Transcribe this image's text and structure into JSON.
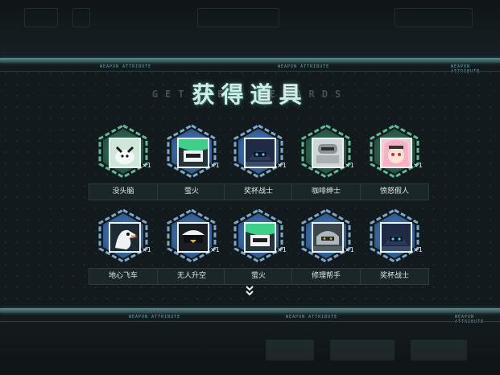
{
  "band_text": "WEAPON ATTRIBUTE",
  "title": {
    "main": "获得道具",
    "ghost": "GET NEW REWARDS"
  },
  "items": [
    {
      "name": "没头脑",
      "qty": "×1",
      "frame": "green",
      "portrait": "white-creature"
    },
    {
      "name": "萤火",
      "qty": "×1",
      "frame": "blue",
      "portrait": "green-hair-visor"
    },
    {
      "name": "奖杯战士",
      "qty": "×1",
      "frame": "blue",
      "portrait": "dark-helmet"
    },
    {
      "name": "咖啡绅士",
      "qty": "×1",
      "frame": "green",
      "portrait": "grey-machine"
    },
    {
      "name": "愤怒假人",
      "qty": "×1",
      "frame": "green",
      "portrait": "pink-hair-girl"
    },
    {
      "name": "地心飞车",
      "qty": "×1",
      "frame": "blue",
      "portrait": "white-bird"
    },
    {
      "name": "无人升空",
      "qty": "×1",
      "frame": "blue",
      "portrait": "white-cap-visor"
    },
    {
      "name": "萤火",
      "qty": "×1",
      "frame": "blue",
      "portrait": "green-hair-visor"
    },
    {
      "name": "修理帮手",
      "qty": "×1",
      "frame": "blue",
      "portrait": "grey-robot"
    },
    {
      "name": "奖杯战士",
      "qty": "×1",
      "frame": "blue",
      "portrait": "dark-helmet"
    }
  ],
  "scroll_hint_icon": "chevron-double-down-icon",
  "colors": {
    "accent_cyan": "#5fd0d0",
    "frame_green": "#3a7a58",
    "frame_blue": "#4a7fb0",
    "background": "#131a1d"
  }
}
